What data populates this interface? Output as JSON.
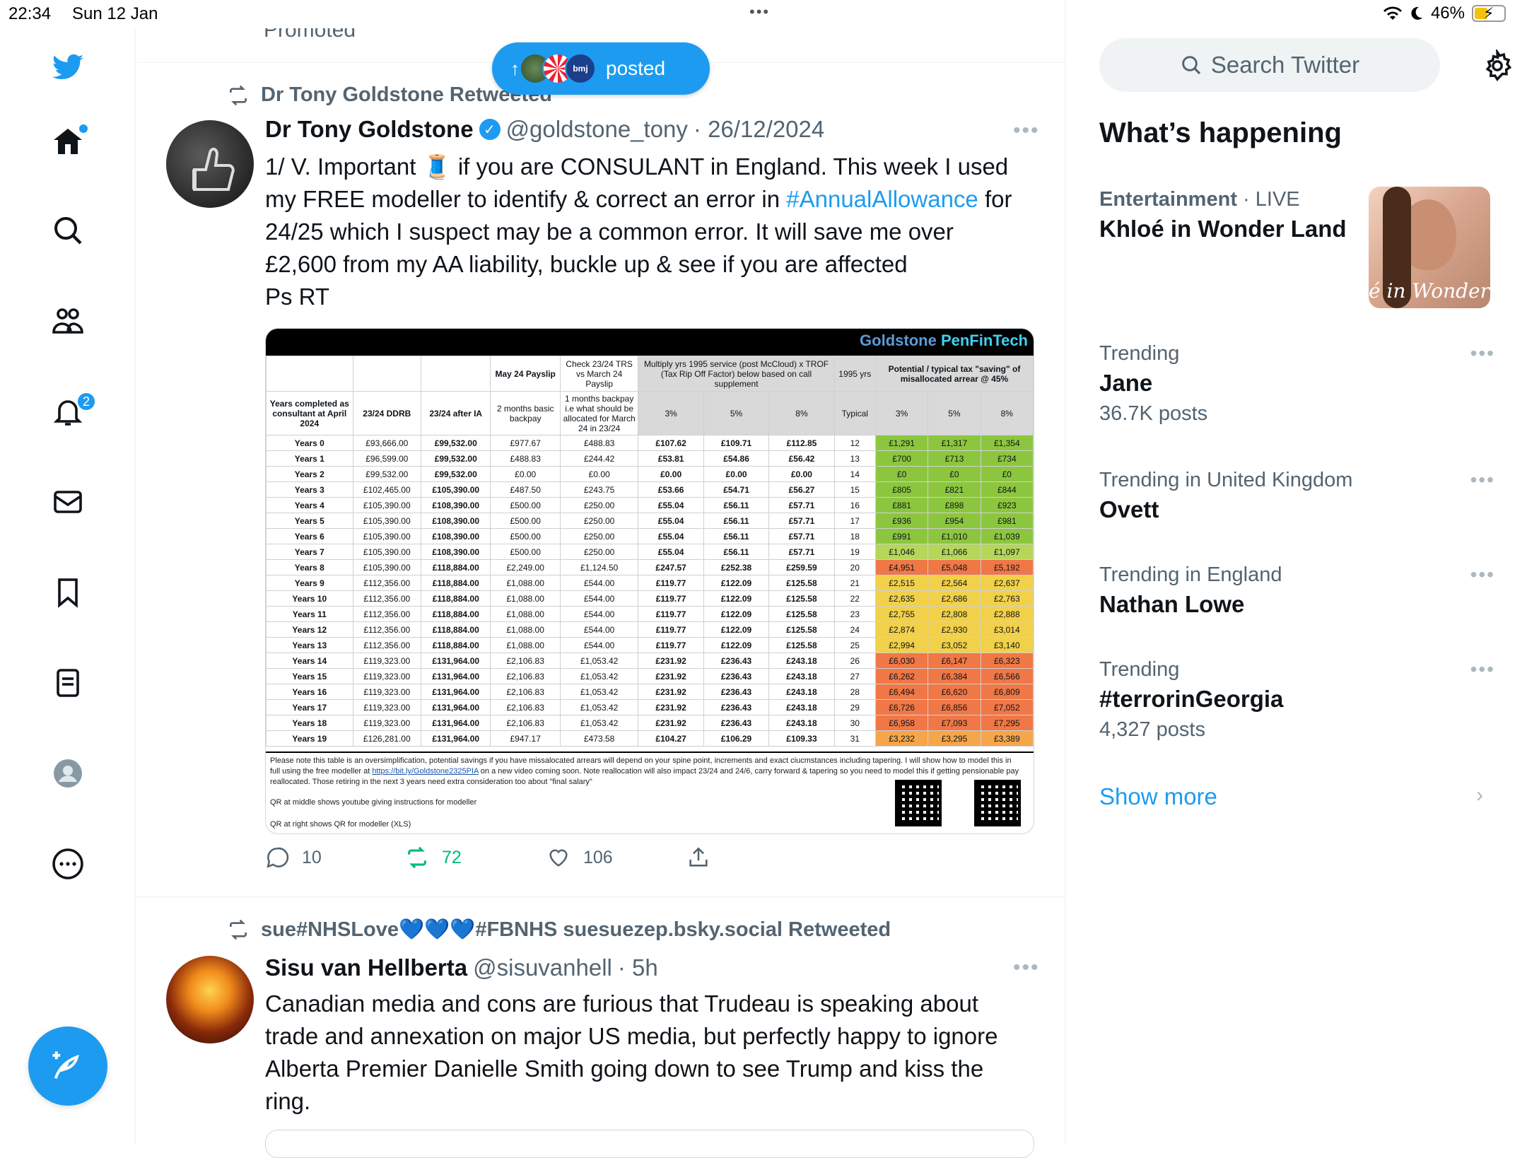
{
  "status": {
    "time": "22:34",
    "date": "Sun 12 Jan",
    "battery": "46%"
  },
  "nav": {
    "notifications_badge": "2"
  },
  "feed": {
    "promoted_label": "Promoted",
    "new_posts_label": "posted",
    "tweet1": {
      "retweeted_by": "Dr Tony Goldstone Retweeted",
      "name": "Dr Tony Goldstone",
      "handle": "@goldstone_tony",
      "date": "· 26/12/2024",
      "text_a": "1/ V. Important 🧵 if you are CONSULANT in England. This week I used my FREE modeller to identify & correct an error in ",
      "hashtag": "#AnnualAllowance",
      "text_b": " for 24/25 which I suspect may be a common error. It will save me over £2,600 from my AA liability, buckle up & see if you are affected",
      "text_c": "Ps RT",
      "replies": "10",
      "retweets": "72",
      "likes": "106",
      "media": {
        "brand_a": "Goldstone ",
        "brand_b": "PenFinTech",
        "header": {
          "may24": "May 24 Payslip",
          "check": "Check 23/24 TRS vs March 24 Payslip",
          "multiply": "Multiply yrs 1995 service (post McCloud) x TROF (Tax Rip Off Factor) below based on call supplement",
          "yrs1995": "1995 yrs",
          "potential": "Potential / typical tax \"saving\" of misallocated arrear @ 45%",
          "years_completed": "Years completed as consultant at April 2024",
          "ddrb": "23/24 DDRB",
          "after_ia": "23/24 after IA",
          "basic": "2 months basic backpay",
          "one_month": "1 months backpay i.e what should be allocated for March 24 in 23/24",
          "p3": "3%",
          "p5": "5%",
          "p8": "8%",
          "typical": "Typical"
        },
        "rows": [
          [
            "Years 0",
            "£93,666.00",
            "£99,532.00",
            "£977.67",
            "£488.83",
            "£107.62",
            "£109.71",
            "£112.85",
            "12",
            "£1,291",
            "£1,317",
            "£1,354",
            "g"
          ],
          [
            "Years 1",
            "£96,599.00",
            "£99,532.00",
            "£488.83",
            "£244.42",
            "£53.81",
            "£54.86",
            "£56.42",
            "13",
            "£700",
            "£713",
            "£734",
            "g"
          ],
          [
            "Years 2",
            "£99,532.00",
            "£99,532.00",
            "£0.00",
            "£0.00",
            "£0.00",
            "£0.00",
            "£0.00",
            "14",
            "£0",
            "£0",
            "£0",
            "g"
          ],
          [
            "Years 3",
            "£102,465.00",
            "£105,390.00",
            "£487.50",
            "£243.75",
            "£53.66",
            "£54.71",
            "£56.27",
            "15",
            "£805",
            "£821",
            "£844",
            "g"
          ],
          [
            "Years 4",
            "£105,390.00",
            "£108,390.00",
            "£500.00",
            "£250.00",
            "£55.04",
            "£56.11",
            "£57.71",
            "16",
            "£881",
            "£898",
            "£923",
            "g"
          ],
          [
            "Years 5",
            "£105,390.00",
            "£108,390.00",
            "£500.00",
            "£250.00",
            "£55.04",
            "£56.11",
            "£57.71",
            "17",
            "£936",
            "£954",
            "£981",
            "g"
          ],
          [
            "Years 6",
            "£105,390.00",
            "£108,390.00",
            "£500.00",
            "£250.00",
            "£55.04",
            "£56.11",
            "£57.71",
            "18",
            "£991",
            "£1,010",
            "£1,039",
            "g"
          ],
          [
            "Years 7",
            "£105,390.00",
            "£108,390.00",
            "£500.00",
            "£250.00",
            "£55.04",
            "£56.11",
            "£57.71",
            "19",
            "£1,046",
            "£1,066",
            "£1,097",
            "lg"
          ],
          [
            "Years 8",
            "£105,390.00",
            "£118,884.00",
            "£2,249.00",
            "£1,124.50",
            "£247.57",
            "£252.38",
            "£259.59",
            "20",
            "£4,951",
            "£5,048",
            "£5,192",
            "r"
          ],
          [
            "Years 9",
            "£112,356.00",
            "£118,884.00",
            "£1,088.00",
            "£544.00",
            "£119.77",
            "£122.09",
            "£125.58",
            "21",
            "£2,515",
            "£2,564",
            "£2,637",
            "y"
          ],
          [
            "Years 10",
            "£112,356.00",
            "£118,884.00",
            "£1,088.00",
            "£544.00",
            "£119.77",
            "£122.09",
            "£125.58",
            "22",
            "£2,635",
            "£2,686",
            "£2,763",
            "y"
          ],
          [
            "Years 11",
            "£112,356.00",
            "£118,884.00",
            "£1,088.00",
            "£544.00",
            "£119.77",
            "£122.09",
            "£125.58",
            "23",
            "£2,755",
            "£2,808",
            "£2,888",
            "y"
          ],
          [
            "Years 12",
            "£112,356.00",
            "£118,884.00",
            "£1,088.00",
            "£544.00",
            "£119.77",
            "£122.09",
            "£125.58",
            "24",
            "£2,874",
            "£2,930",
            "£3,014",
            "y"
          ],
          [
            "Years 13",
            "£112,356.00",
            "£118,884.00",
            "£1,088.00",
            "£544.00",
            "£119.77",
            "£122.09",
            "£125.58",
            "25",
            "£2,994",
            "£3,052",
            "£3,140",
            "y"
          ],
          [
            "Years 14",
            "£119,323.00",
            "£131,964.00",
            "£2,106.83",
            "£1,053.42",
            "£231.92",
            "£236.43",
            "£243.18",
            "26",
            "£6,030",
            "£6,147",
            "£6,323",
            "r"
          ],
          [
            "Years 15",
            "£119,323.00",
            "£131,964.00",
            "£2,106.83",
            "£1,053.42",
            "£231.92",
            "£236.43",
            "£243.18",
            "27",
            "£6,262",
            "£6,384",
            "£6,566",
            "r"
          ],
          [
            "Years 16",
            "£119,323.00",
            "£131,964.00",
            "£2,106.83",
            "£1,053.42",
            "£231.92",
            "£236.43",
            "£243.18",
            "28",
            "£6,494",
            "£6,620",
            "£6,809",
            "r"
          ],
          [
            "Years 17",
            "£119,323.00",
            "£131,964.00",
            "£2,106.83",
            "£1,053.42",
            "£231.92",
            "£236.43",
            "£243.18",
            "29",
            "£6,726",
            "£6,856",
            "£7,052",
            "r"
          ],
          [
            "Years 18",
            "£119,323.00",
            "£131,964.00",
            "£2,106.83",
            "£1,053.42",
            "£231.92",
            "£236.43",
            "£243.18",
            "30",
            "£6,958",
            "£7,093",
            "£7,295",
            "r"
          ],
          [
            "Years 19",
            "£126,281.00",
            "£131,964.00",
            "£947.17",
            "£473.58",
            "£104.27",
            "£106.29",
            "£109.33",
            "31",
            "£3,232",
            "£3,295",
            "£3,389",
            "o"
          ]
        ],
        "footnote_a": "Please note this table is an oversimplification, potential savings if you have missalocated arrears will depend on your spine point, increments and exact ciucmstances including tapering. I will show how to model this in full using the free modeller at ",
        "footnote_link": "https://bit.ly/Goldstone2325PIA",
        "footnote_b": " on a new video coming soon. Note reallocation will also impact 23/24 and 24/6, carry forward & tapering so you need to model this if getting pensionable pay reallocated. Those retiring in the next 3 years need extra consideration too about \"final salary\"",
        "qr_middle": "QR at middle shows youtube giving instructions for modeller",
        "qr_right": "QR at right shows QR for modeller (XLS)"
      }
    },
    "tweet2": {
      "retweeted_by": "sue#NHSLove💙💙💙#FBNHS suesuezep.bsky.social Retweeted",
      "name": "Sisu van Hellberta",
      "handle": "@sisuvanhell",
      "date": "· 5h",
      "text": "Canadian media and cons are furious that Trudeau is speaking about trade and annexation on major US media, but perfectly happy to ignore Alberta Premier Danielle Smith going down to see Trump and kiss the ring."
    }
  },
  "sidebar": {
    "search_placeholder": "Search Twitter",
    "whats_happening": "What’s happening",
    "trends": [
      {
        "context": "Entertainment",
        "live": " · LIVE",
        "title": "Khloé in Wonder Land",
        "count": "",
        "image_text": "é in Wonder L"
      },
      {
        "context": "Trending",
        "title": "Jane",
        "count": "36.7K posts"
      },
      {
        "context": "Trending in United Kingdom",
        "title": "Ovett",
        "count": ""
      },
      {
        "context": "Trending in England",
        "title": "Nathan Lowe",
        "count": ""
      },
      {
        "context": "Trending",
        "title": "#terrorinGeorgia",
        "count": "4,327 posts"
      }
    ],
    "show_more": "Show more"
  },
  "colors": {
    "accent": "#1d9bf0",
    "retweet_green": "#00ba7c",
    "muted": "#536471"
  },
  "icons": [
    "twitter-bird-icon",
    "home-icon",
    "search-icon",
    "communities-icon",
    "bell-icon",
    "mail-icon",
    "bookmark-icon",
    "list-icon",
    "profile-icon",
    "more-circle-icon",
    "compose-icon",
    "retweet-icon",
    "reply-icon",
    "like-icon",
    "share-icon",
    "gear-icon",
    "chevron-right-icon"
  ]
}
